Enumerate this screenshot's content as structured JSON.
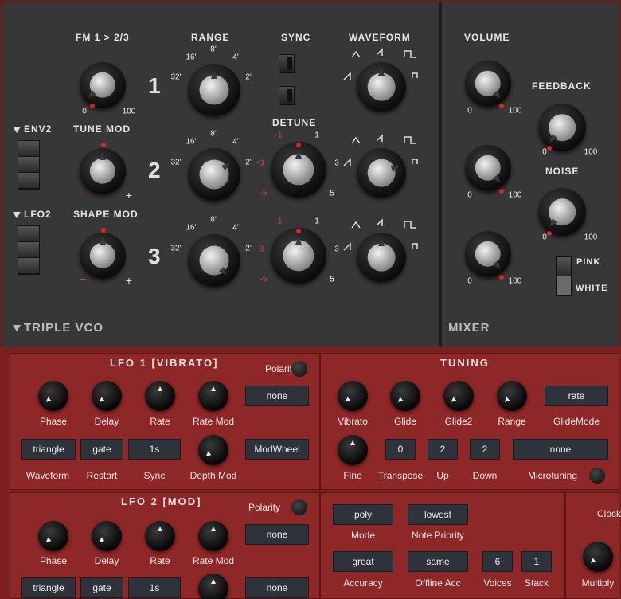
{
  "vco": {
    "fm_label": "FM 1 > 2/3",
    "range_label": "RANGE",
    "sync_label": "SYNC",
    "waveform_label": "WAVEFORM",
    "detune_label": "DETUNE",
    "env2_label": "ENV2",
    "tune_mod_label": "TUNE MOD",
    "lfo2_label": "LFO2",
    "shape_mod_label": "SHAPE MOD",
    "osc1": "1",
    "osc2": "2",
    "osc3": "3",
    "range_ticks": [
      "16'",
      "8'",
      "4'",
      "32'",
      "2'"
    ],
    "knob_min": "0",
    "knob_max": "100",
    "minus": "−",
    "plus": "+",
    "detune_ticks": [
      "-1",
      "1",
      "-3",
      "3",
      "-5",
      "5"
    ],
    "section_title": "TRIPLE VCO"
  },
  "mixer": {
    "volume_label": "VOLUME",
    "feedback_label": "FEEDBACK",
    "noise_label": "NOISE",
    "pink_label": "PINK",
    "white_label": "WHITE",
    "knob_min": "0",
    "knob_max": "100",
    "section_title": "MIXER"
  },
  "lfo1": {
    "title": "LFO 1 [VIBRATO]",
    "polarity": "Polarity",
    "none1": "none",
    "phase": "Phase",
    "delay": "Delay",
    "rate": "Rate",
    "rate_mod": "Rate Mod",
    "waveform_value": "triangle",
    "restart_value": "gate",
    "sync_value": "1s",
    "modwheel_value": "ModWheel",
    "waveform": "Waveform",
    "restart": "Restart",
    "sync": "Sync",
    "depth_mod": "Depth Mod"
  },
  "tuning": {
    "title": "TUNING",
    "rate_value": "rate",
    "vibrato": "Vibrato",
    "glide": "Glide",
    "glide2": "Glide2",
    "range": "Range",
    "glidemode": "GlideMode",
    "transpose_value": "0",
    "up_value": "2",
    "down_value": "2",
    "micro_value": "none",
    "fine": "Fine",
    "transpose": "Transpose",
    "up": "Up",
    "down": "Down",
    "microtuning": "Microtuning"
  },
  "lfo2": {
    "title": "LFO 2 [MOD]",
    "polarity": "Polarity",
    "none1": "none",
    "phase": "Phase",
    "delay": "Delay",
    "rate": "Rate",
    "rate_mod": "Rate Mod",
    "waveform_value": "triangle",
    "restart_value": "gate",
    "sync_value": "1s",
    "none2": "none"
  },
  "voice": {
    "mode_value": "poly",
    "priority_value": "lowest",
    "mode": "Mode",
    "priority": "Note Priority",
    "accuracy_value": "great",
    "offline_value": "same",
    "voices_value": "6",
    "stack_value": "1",
    "accuracy": "Accuracy",
    "offline": "Offline Acc",
    "voices": "Voices",
    "stack": "Stack"
  },
  "clock": {
    "clock": "Clock",
    "multiply": "Multiply"
  }
}
